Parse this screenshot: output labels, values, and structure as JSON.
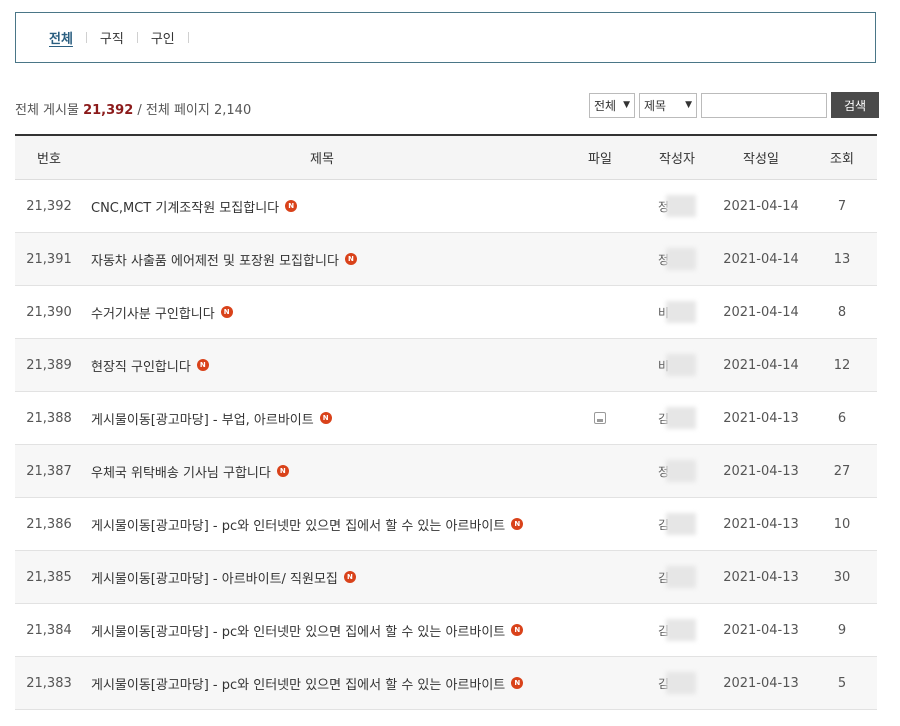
{
  "category_tabs": [
    {
      "label": "전체",
      "active": true
    },
    {
      "label": "구직",
      "active": false
    },
    {
      "label": "구인",
      "active": false
    }
  ],
  "summary": {
    "total_posts_label": "전체 게시물",
    "total_posts": "21,392",
    "separator": "/",
    "total_pages_label": "전체 페이지",
    "total_pages": "2,140"
  },
  "search": {
    "scope_value": "전체",
    "field_value": "제목",
    "query_value": "",
    "button_label": "검색"
  },
  "table": {
    "columns": [
      "번호",
      "제목",
      "파일",
      "작성자",
      "작성일",
      "조회"
    ],
    "rows": [
      {
        "no": "21,392",
        "title": "CNC,MCT 기계조작원 모집합니다",
        "file": false,
        "author_initial": "정",
        "date": "2021-04-14",
        "views": "7"
      },
      {
        "no": "21,391",
        "title": "자동차 사출품 에어제전 및 포장원 모집합니다",
        "file": false,
        "author_initial": "정",
        "date": "2021-04-14",
        "views": "13"
      },
      {
        "no": "21,390",
        "title": "수거기사분 구인합니다",
        "file": false,
        "author_initial": "비",
        "date": "2021-04-14",
        "views": "8"
      },
      {
        "no": "21,389",
        "title": "현장직 구인합니다",
        "file": false,
        "author_initial": "비",
        "date": "2021-04-14",
        "views": "12"
      },
      {
        "no": "21,388",
        "title": "게시물이동[광고마당] - 부업, 아르바이트",
        "file": true,
        "author_initial": "김",
        "date": "2021-04-13",
        "views": "6"
      },
      {
        "no": "21,387",
        "title": "우체국 위탁배송 기사님 구합니다",
        "file": false,
        "author_initial": "정",
        "date": "2021-04-13",
        "views": "27"
      },
      {
        "no": "21,386",
        "title": "게시물이동[광고마당] - pc와 인터넷만 있으면 집에서 할 수 있는 아르바이트",
        "file": false,
        "author_initial": "김",
        "date": "2021-04-13",
        "views": "10"
      },
      {
        "no": "21,385",
        "title": "게시물이동[광고마당] - 아르바이트/ 직원모집",
        "file": false,
        "author_initial": "김",
        "date": "2021-04-13",
        "views": "30"
      },
      {
        "no": "21,384",
        "title": "게시물이동[광고마당] - pc와 인터넷만 있으면 집에서 할 수 있는 아르바이트",
        "file": false,
        "author_initial": "김",
        "date": "2021-04-13",
        "views": "9"
      },
      {
        "no": "21,383",
        "title": "게시물이동[광고마당] - pc와 인터넷만 있으면 집에서 할 수 있는 아르바이트",
        "file": false,
        "author_initial": "김",
        "date": "2021-04-13",
        "views": "5"
      }
    ]
  },
  "new_badge": "N",
  "colors": {
    "accent_border": "#4a7687",
    "count_highlight": "#8b1a1a",
    "new_badge": "#d9421a",
    "search_button": "#4a4a4a"
  },
  "icons": {
    "new": "new-badge-icon",
    "file": "file-attachment-icon",
    "dropdown": "chevron-down-icon"
  }
}
